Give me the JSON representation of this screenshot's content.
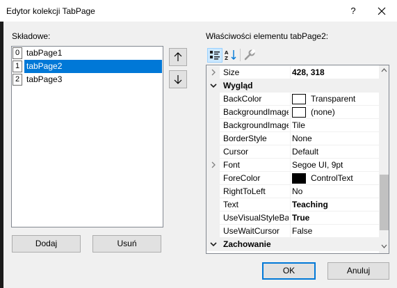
{
  "window": {
    "title": "Edytor kolekcji TabPage",
    "help_label": "?"
  },
  "members": {
    "label": "Składowe:",
    "items": [
      {
        "index": "0",
        "name": "tabPage1",
        "selected": false
      },
      {
        "index": "1",
        "name": "tabPage2",
        "selected": true
      },
      {
        "index": "2",
        "name": "tabPage3",
        "selected": false
      }
    ],
    "add_label": "Dodaj",
    "remove_label": "Usuń"
  },
  "properties": {
    "label": "Właściwości elementu tabPage2:",
    "rows": [
      {
        "kind": "prop",
        "name": "Size",
        "value": "428, 318",
        "bold": true,
        "expandable": true
      },
      {
        "kind": "category",
        "name": "Wygląd"
      },
      {
        "kind": "prop",
        "name": "BackColor",
        "value": "Transparent",
        "swatch": "#ffffff"
      },
      {
        "kind": "prop",
        "name": "BackgroundImage",
        "value": "(none)",
        "swatch": "#ffffff"
      },
      {
        "kind": "prop",
        "name": "BackgroundImage",
        "value": "Tile"
      },
      {
        "kind": "prop",
        "name": "BorderStyle",
        "value": "None"
      },
      {
        "kind": "prop",
        "name": "Cursor",
        "value": "Default"
      },
      {
        "kind": "prop",
        "name": "Font",
        "value": "Segoe UI, 9pt",
        "expandable": true
      },
      {
        "kind": "prop",
        "name": "ForeColor",
        "value": "ControlText",
        "swatch": "#000000"
      },
      {
        "kind": "prop",
        "name": "RightToLeft",
        "value": "No"
      },
      {
        "kind": "prop",
        "name": "Text",
        "value": "Teaching",
        "bold": true
      },
      {
        "kind": "prop",
        "name": "UseVisualStyleBac",
        "value": "True",
        "bold": true
      },
      {
        "kind": "prop",
        "name": "UseWaitCursor",
        "value": "False"
      },
      {
        "kind": "category",
        "name": "Zachowanie"
      }
    ]
  },
  "footer": {
    "ok_label": "OK",
    "cancel_label": "Anuluj"
  },
  "colors": {
    "accent": "#0078d7",
    "selection_text": "#ffffff",
    "dialog_bg": "#f0f0f0"
  }
}
